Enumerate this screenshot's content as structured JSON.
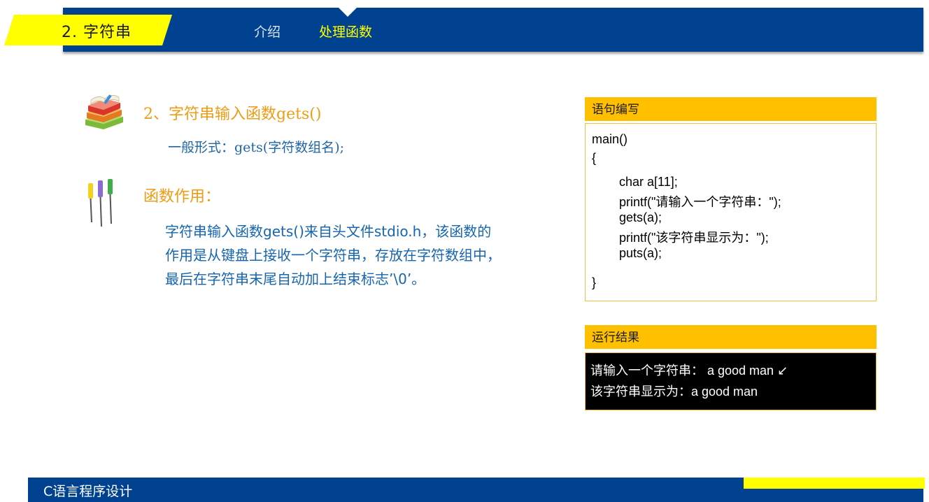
{
  "header": {
    "chapter_title": "2. 字符串",
    "tabs": [
      {
        "label": "介绍",
        "active": false
      },
      {
        "label": "处理函数",
        "active": true
      }
    ]
  },
  "main": {
    "heading1": "2、字符串输入函数gets()",
    "general_form": "一般形式：gets(字符数组名);",
    "heading2": "函数作用：",
    "description_lines": [
      "字符串输入函数gets()来自头文件stdio.h，该函数的",
      "作用是从键盘上接收一个字符串，存放在字符数组中，",
      "最后在字符串末尾自动加上结束标志’\\0’。"
    ],
    "icons": [
      "books-icon",
      "screwdrivers-icon"
    ]
  },
  "code_panel": {
    "title": "语句编写",
    "lines": [
      "main()",
      "{",
      "char a[11];",
      "printf(\"请输入一个字符串：\");",
      "gets(a);",
      "printf(\"该字符串显示为：\");",
      "puts(a);",
      "}"
    ]
  },
  "result_panel": {
    "title": "运行结果",
    "lines": [
      "请输入一个字符串： a good man ↙",
      "该字符串显示为：a good man"
    ]
  },
  "footer": {
    "course_title": "C语言程序设计"
  },
  "colors": {
    "navy": "#00428f",
    "yellow": "#ffff00",
    "amber": "#ffc000",
    "orange_text": "#ef9b14",
    "blue_text": "#1565b0"
  }
}
